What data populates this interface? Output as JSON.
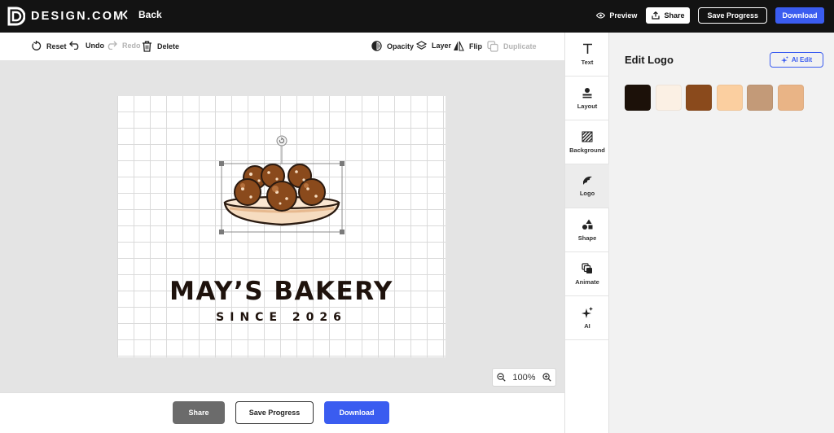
{
  "brand": {
    "name": "DESIGN.COM"
  },
  "topbar": {
    "back_label": "Back",
    "preview_label": "Preview",
    "share_label": "Share",
    "save_label": "Save Progress",
    "download_label": "Download",
    "accent_color": "#3a5cf0"
  },
  "toolbar": {
    "reset": "Reset",
    "undo": "Undo",
    "redo": "Redo",
    "delete": "Delete",
    "opacity": "Opacity",
    "layer": "Layer",
    "flip": "Flip",
    "duplicate": "Duplicate"
  },
  "canvas": {
    "logo_title": "MAY’S BAKERY",
    "logo_subtitle": "SINCE 2026",
    "logo_icon": "cookies-in-bowl"
  },
  "zoom": {
    "level": "100%"
  },
  "bottom": {
    "share_label": "Share",
    "save_label": "Save Progress",
    "download_label": "Download"
  },
  "sidenav": {
    "items": [
      {
        "label": "Text",
        "icon": "text-icon"
      },
      {
        "label": "Layout",
        "icon": "layout-icon"
      },
      {
        "label": "Background",
        "icon": "background-icon"
      },
      {
        "label": "Logo",
        "icon": "logo-icon",
        "active": true
      },
      {
        "label": "Shape",
        "icon": "shape-icon"
      },
      {
        "label": "Animate",
        "icon": "animate-icon"
      },
      {
        "label": "AI",
        "icon": "ai-sparkle-icon"
      }
    ]
  },
  "panel": {
    "title": "Edit Logo",
    "ai_edit_label": "AI Edit",
    "swatches": [
      "#1c1109",
      "#fbf0e4",
      "#8a4a1c",
      "#fbcfa0",
      "#c39a78",
      "#e9b486"
    ]
  }
}
